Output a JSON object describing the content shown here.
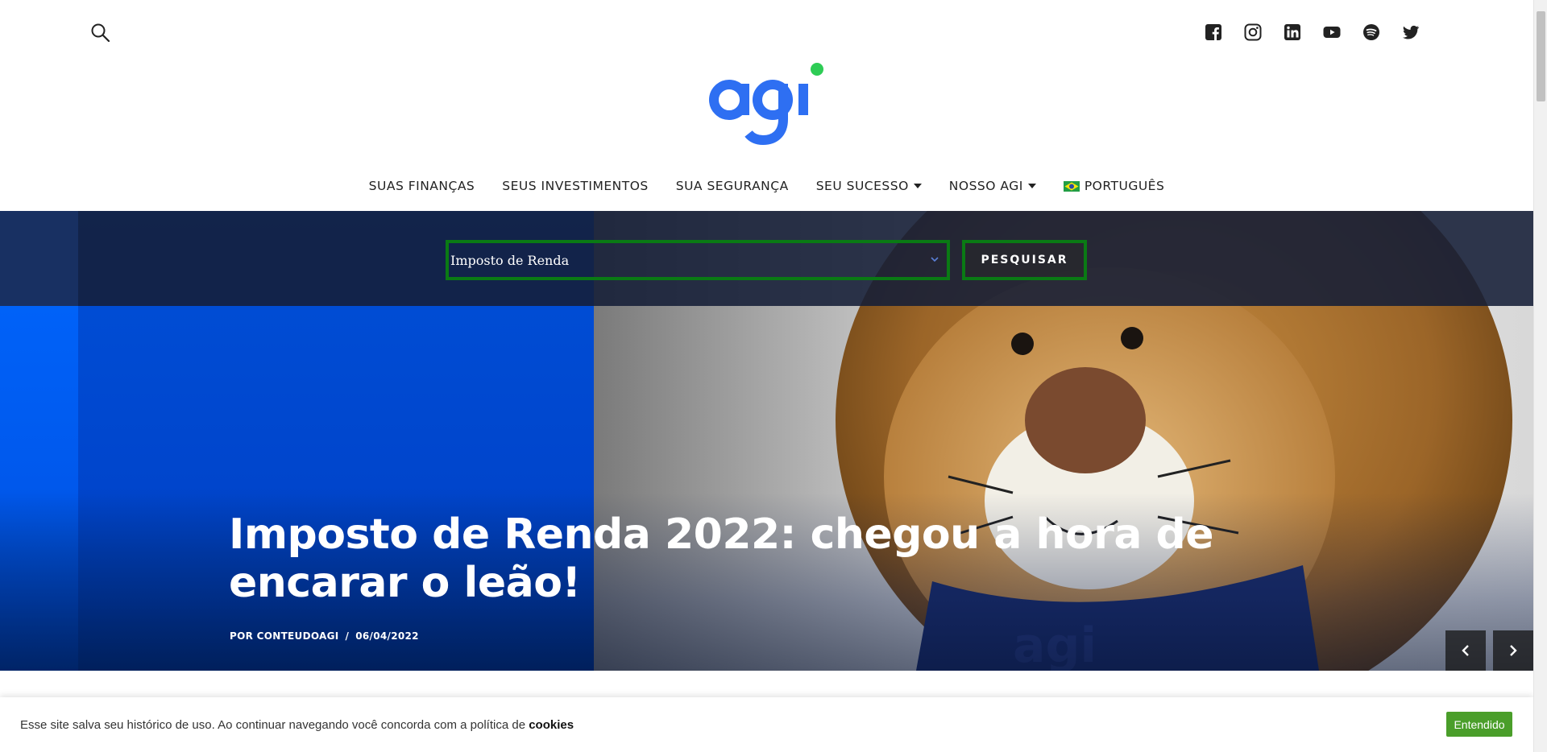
{
  "header": {
    "logo_text": "agi",
    "social": [
      {
        "name": "facebook"
      },
      {
        "name": "instagram"
      },
      {
        "name": "linkedin"
      },
      {
        "name": "youtube"
      },
      {
        "name": "spotify"
      },
      {
        "name": "twitter"
      }
    ]
  },
  "nav": {
    "items": [
      {
        "label": "SUAS FINANÇAS"
      },
      {
        "label": "SEUS INVESTIMENTOS"
      },
      {
        "label": "SUA SEGURANÇA"
      },
      {
        "label": "SEU SUCESSO"
      },
      {
        "label": "NOSSO AGI"
      },
      {
        "label": "PORTUGUÊS"
      }
    ]
  },
  "search": {
    "value": "Imposto de Renda",
    "button_label": "PESQUISAR"
  },
  "hero": {
    "title": "Imposto de Renda 2022: chegou a hora de encarar o leão!",
    "author": "POR CONTEUDOAGI",
    "separator": "/",
    "date": "06/04/2022"
  },
  "cookie": {
    "text": "Esse site salva seu histórico de uso. Ao continuar navegando você concorda com a política de",
    "link": "cookies",
    "button_label": "Entendido"
  },
  "colors": {
    "brand_blue": "#2e6ff2",
    "brand_green": "#2ecc55",
    "focus_green": "#0a7a14",
    "cookie_button": "#4a9e2a"
  }
}
